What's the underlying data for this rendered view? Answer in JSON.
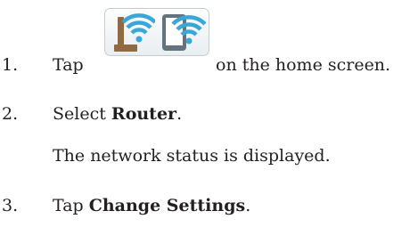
{
  "steps": [
    {
      "number": "1.",
      "before": "Tap",
      "after": "on the home screen.",
      "icon": "wifi-router-and-wifi-direct-icon",
      "colors": {
        "router": "#8f6a43",
        "wave": "#3aa7d9",
        "device": "#64737e"
      }
    },
    {
      "number": "2.",
      "before": "Select",
      "bold": "Router",
      "after": ".",
      "note": "The network status is displayed."
    },
    {
      "number": "3.",
      "before": "Tap",
      "bold": "Change Settings",
      "after": "."
    }
  ]
}
